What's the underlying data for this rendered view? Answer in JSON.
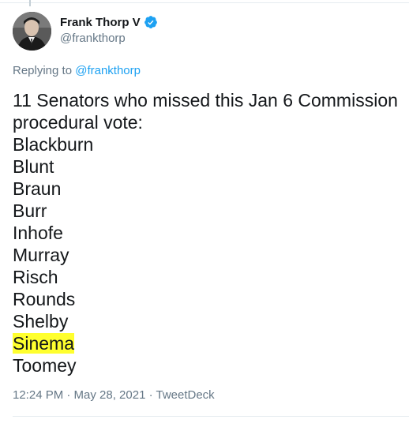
{
  "author": {
    "display_name": "Frank Thorp V",
    "handle": "@frankthorp",
    "verified": true,
    "avatar_icon": "profile-photo-avatar"
  },
  "reply": {
    "prefix": "Replying to",
    "mention": "@frankthorp"
  },
  "tweet": {
    "lines": [
      "11 Senators who missed this Jan 6 Commission",
      "procedural vote:",
      "Blackburn",
      "Blunt",
      "Braun",
      "Burr",
      "Inhofe",
      "Murray",
      "Risch",
      "Rounds",
      "Shelby",
      "Sinema",
      "Toomey"
    ],
    "highlighted_line": "Sinema",
    "highlight_color": "#ffff2e"
  },
  "meta": {
    "timestamp": "12:24 PM · May 28, 2021 · TweetDeck"
  },
  "colors": {
    "link": "#1da1f2",
    "muted": "#657786",
    "text": "#14171a",
    "verified_badge": "#1da1f2"
  }
}
